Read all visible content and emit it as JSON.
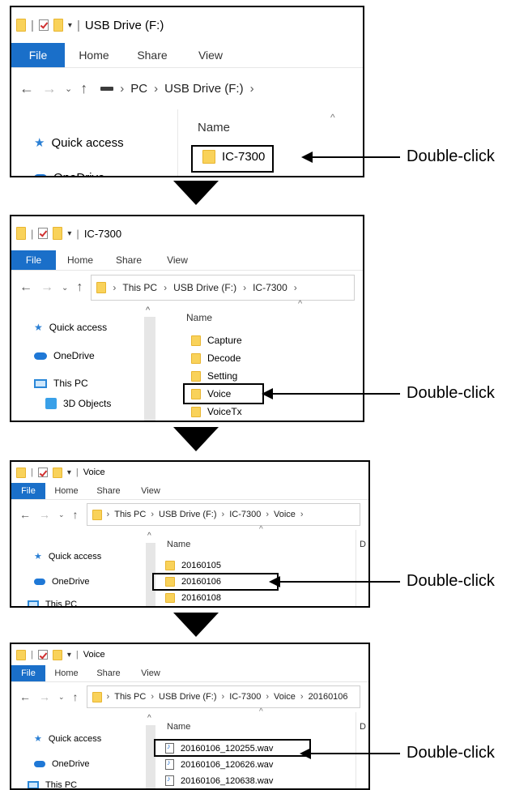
{
  "callout_label": "Double-click",
  "ribbon": {
    "file": "File",
    "home": "Home",
    "share": "Share",
    "view": "View"
  },
  "column_name": "Name",
  "column_date_partial": "D",
  "panel1": {
    "title": "USB Drive (F:)",
    "path": [
      "PC",
      "USB Drive (F:)"
    ],
    "nav": [
      {
        "label": "Quick access"
      },
      {
        "label": "OneDrive"
      }
    ],
    "rows": [
      "IC-7300"
    ]
  },
  "panel2": {
    "title": "IC-7300",
    "path": [
      "This PC",
      "USB Drive (F:)",
      "IC-7300"
    ],
    "nav": [
      {
        "label": "Quick access"
      },
      {
        "label": "OneDrive"
      },
      {
        "label": "This PC"
      },
      {
        "label": "3D Objects"
      }
    ],
    "rows": [
      "Capture",
      "Decode",
      "Setting",
      "Voice",
      "VoiceTx"
    ]
  },
  "panel3": {
    "title": "Voice",
    "path": [
      "This PC",
      "USB Drive (F:)",
      "IC-7300",
      "Voice"
    ],
    "nav": [
      {
        "label": "Quick access"
      },
      {
        "label": "OneDrive"
      },
      {
        "label": "This PC"
      }
    ],
    "rows": [
      "20160105",
      "20160106",
      "20160108"
    ]
  },
  "panel4": {
    "title": "Voice",
    "path": [
      "This PC",
      "USB Drive (F:)",
      "IC-7300",
      "Voice",
      "20160106"
    ],
    "nav": [
      {
        "label": "Quick access"
      },
      {
        "label": "OneDrive"
      },
      {
        "label": "This PC"
      }
    ],
    "rows": [
      "20160106_120255.wav",
      "20160106_120626.wav",
      "20160106_120638.wav"
    ]
  }
}
